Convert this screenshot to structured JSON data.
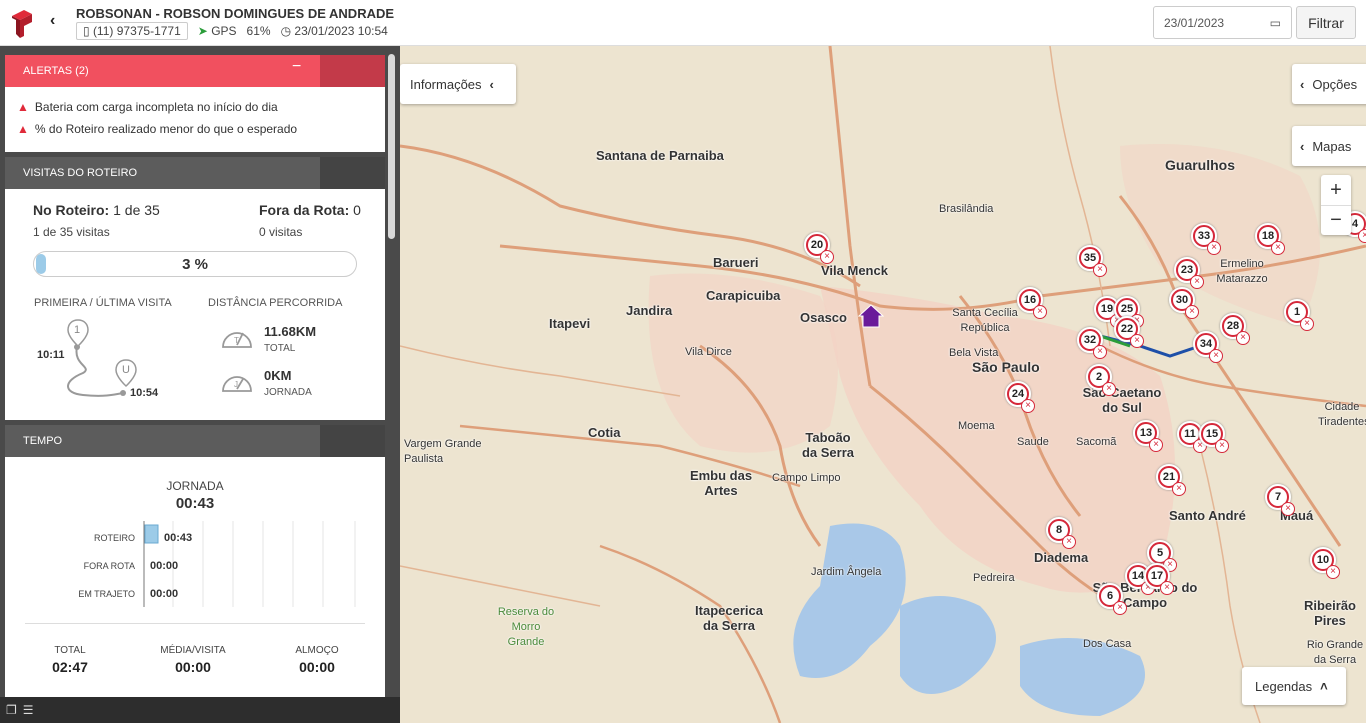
{
  "header": {
    "title": "ROBSONAN - ROBSON DOMINGUES DE ANDRADE",
    "phone": "(11) 97375-1771",
    "gps": "GPS",
    "battery": "61%",
    "datetime": "23/01/2023 10:54",
    "date_value": "23/01/2023",
    "filter_label": "Filtrar"
  },
  "alerts": {
    "title": "ALERTAS (2)",
    "items": [
      "Bateria com carga incompleta no início do dia",
      "% do Roteiro realizado menor do que o esperado"
    ]
  },
  "roteiro": {
    "title": "VISITAS DO ROTEIRO",
    "no_roteiro_label": "No Roteiro:",
    "no_roteiro_value": "1 de 35",
    "no_roteiro_sub": "1 de 35 visitas",
    "fora_label": "Fora da Rota:",
    "fora_value": "0",
    "fora_sub": "0 visitas",
    "progress_pct": 3,
    "progress_text": "3 %",
    "primeira_label": "PRIMEIRA / ÚLTIMA VISITA",
    "first_time": "10:11",
    "last_time": "10:54",
    "pin_first": "1",
    "pin_last": "U",
    "distancia_label": "DISTÂNCIA PERCORRIDA",
    "total_km": "11.68KM",
    "total_lbl": "TOTAL",
    "jornada_km": "0KM",
    "jornada_lbl": "JORNADA"
  },
  "tempo": {
    "title": "TEMPO",
    "jornada_label": "JORNADA",
    "jornada_value": "00:43",
    "bars": [
      {
        "label": "ROTEIRO",
        "value": "00:43"
      },
      {
        "label": "FORA ROTA",
        "value": "00:00"
      },
      {
        "label": "EM TRAJETO",
        "value": "00:00"
      }
    ],
    "stats": [
      {
        "label": "TOTAL",
        "value": "02:47"
      },
      {
        "label": "MÉDIA/VISITA",
        "value": "00:00"
      },
      {
        "label": "ALMOÇO",
        "value": "00:00"
      }
    ]
  },
  "map": {
    "info_btn": "Informações",
    "options_btn": "Opções",
    "maps_btn": "Mapas",
    "legend_btn": "Legendas",
    "zoom_in": "+",
    "zoom_out": "−",
    "labels": [
      "Santana de Parnaiba",
      "Barueri",
      "Vila Menck",
      "Carapicuiba",
      "Osasco",
      "Jandira",
      "Itapevi",
      "Brasilândia",
      "Guarulhos",
      "Santa Cecília República",
      "Bela Vista",
      "São Paulo",
      "Vila Dirce",
      "Taboão da Serra",
      "Cotia",
      "Embu das Artes",
      "Campo Limpo",
      "Moema",
      "Saude",
      "Sacomã",
      "São Caetano do Sul",
      "Santo André",
      "Mauá",
      "Diadema",
      "São Bernardo do Campo",
      "Jardim Ângela",
      "Pedreira",
      "Itapecerica da Serra",
      "Vargem Grande Paulista",
      "Reserva do Morro Grande",
      "Ribeirão Pires",
      "Rio Grande da Serra",
      "Ermelino Matarazzo",
      "Cidade Tiradentes",
      "Dos Casa"
    ],
    "pins": [
      "20",
      "35",
      "16",
      "19",
      "25",
      "22",
      "32",
      "30",
      "23",
      "33",
      "18",
      "1",
      "28",
      "34",
      "2",
      "24",
      "13",
      "11",
      "15",
      "21",
      "7",
      "8",
      "5",
      "14",
      "17",
      "6",
      "10",
      "4"
    ]
  }
}
